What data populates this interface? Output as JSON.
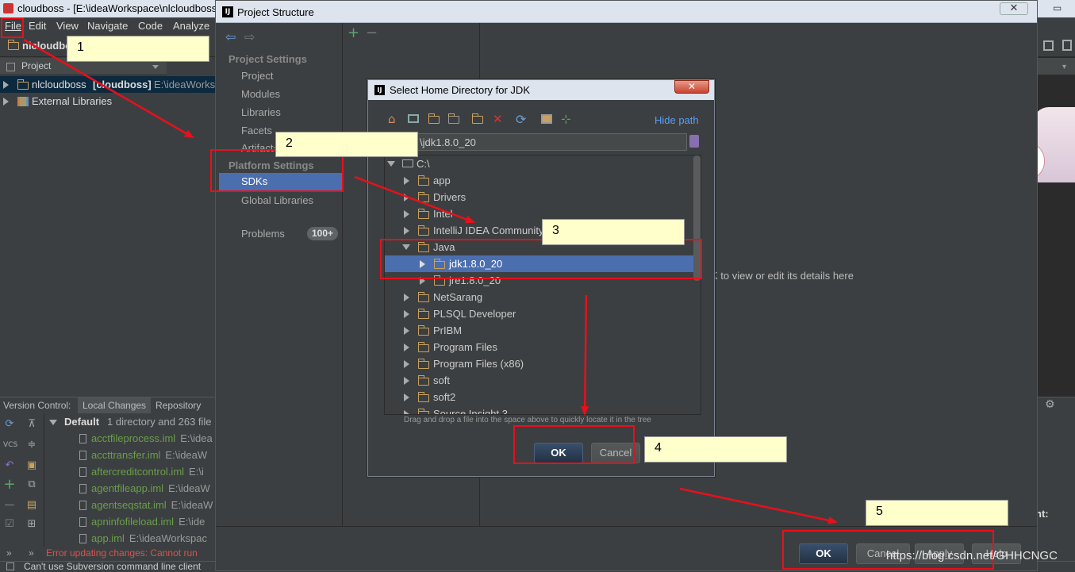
{
  "ide": {
    "window_title": "cloudboss - [E:\\ideaWorkspace\\nlcloudboss",
    "menu": [
      "File",
      "Edit",
      "View",
      "Navigate",
      "Code",
      "Analyze"
    ],
    "project_label": "nlcloudbo",
    "panel_selector": "Project",
    "tree": {
      "root_name": "nlcloudboss",
      "root_module": "[cloudboss]",
      "root_path": "E:\\ideaWorks",
      "external_libraries": "External Libraries"
    },
    "bottom_tabs": [
      "Version Control:",
      "Local Changes",
      "Repository"
    ],
    "changes": {
      "group_label": "Default",
      "group_summary": "1 directory and 263 file",
      "files": [
        {
          "name": "acctfileprocess.iml",
          "path": "E:\\idea"
        },
        {
          "name": "accttransfer.iml",
          "path": "E:\\ideaW"
        },
        {
          "name": "aftercreditcontrol.iml",
          "path": "E:\\i"
        },
        {
          "name": "agentfileapp.iml",
          "path": "E:\\ideaW"
        },
        {
          "name": "agentseqstat.iml",
          "path": "E:\\ideaW"
        },
        {
          "name": "apninfofileload.iml",
          "path": "E:\\ide"
        },
        {
          "name": "app.iml",
          "path": "E:\\ideaWorkspac"
        }
      ]
    },
    "error_text": "Error updating changes: Cannot run",
    "status_text": "Can't use Subversion command line client",
    "bubble_text": "中 简",
    "right_text": "nt:",
    "watermark": "https://blog.csdn.net/GHHCNGC"
  },
  "project_structure": {
    "title": "Project Structure",
    "sections": {
      "project_settings": "Project Settings",
      "project_items": [
        "Project",
        "Modules",
        "Libraries",
        "Facets",
        "Artifacts"
      ],
      "platform_settings": "Platform Settings",
      "platform_items": [
        "SDKs",
        "Global Libraries"
      ],
      "problems": "Problems",
      "problems_count": "100+"
    },
    "hint_text": "K to view or edit its details here",
    "buttons": {
      "ok": "OK",
      "cancel": "Cancel",
      "apply": "Apply",
      "help": "Help"
    }
  },
  "jdk_dialog": {
    "title": "Select Home Directory for JDK",
    "hide_path": "Hide path",
    "path_value": "\\jdk1.8.0_20",
    "root": "C:\\",
    "folders": [
      "app",
      "Drivers",
      "Intel",
      "IntelliJ IDEA Community",
      "Java",
      "jdk1.8.0_20",
      "jre1.8.0_20",
      "NetSarang",
      "PLSQL Developer",
      "PrIBM",
      "Program Files",
      "Program Files (x86)",
      "soft",
      "soft2",
      "Source Insight 3"
    ],
    "drag_hint": "Drag and drop a file into the space above to quickly locate it in the tree",
    "buttons": {
      "ok": "OK",
      "cancel": "Cancel"
    }
  },
  "callouts": [
    "1",
    "2",
    "3",
    "4",
    "5"
  ],
  "colors": {
    "annotation_red": "#e8101a",
    "note_bg": "#ffffcc",
    "selection": "#4b6eaf",
    "ide_bg": "#3c3f41",
    "editor_bg": "#2b2b2b"
  }
}
